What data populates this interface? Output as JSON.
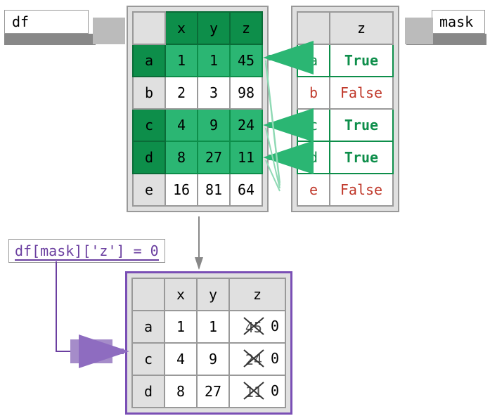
{
  "labels": {
    "df": "df",
    "mask": "mask",
    "code": "df[mask]['z'] = 0"
  },
  "df": {
    "columns": [
      "x",
      "y",
      "z"
    ],
    "index": [
      "a",
      "b",
      "c",
      "d",
      "e"
    ],
    "data": [
      [
        1,
        1,
        45
      ],
      [
        2,
        3,
        98
      ],
      [
        4,
        9,
        24
      ],
      [
        8,
        27,
        11
      ],
      [
        16,
        81,
        64
      ]
    ],
    "selected_rows": [
      "a",
      "c",
      "d"
    ]
  },
  "mask": {
    "column": "z",
    "index": [
      "a",
      "b",
      "c",
      "d",
      "e"
    ],
    "values": [
      "True",
      "False",
      "True",
      "True",
      "False"
    ]
  },
  "result": {
    "columns": [
      "x",
      "y",
      "z"
    ],
    "index": [
      "a",
      "c",
      "d"
    ],
    "data": [
      {
        "x": 1,
        "y": 1,
        "z_old": 45,
        "z_new": 0
      },
      {
        "x": 4,
        "y": 9,
        "z_old": 24,
        "z_new": 0
      },
      {
        "x": 8,
        "y": 27,
        "z_old": 11,
        "z_new": 0
      }
    ]
  }
}
